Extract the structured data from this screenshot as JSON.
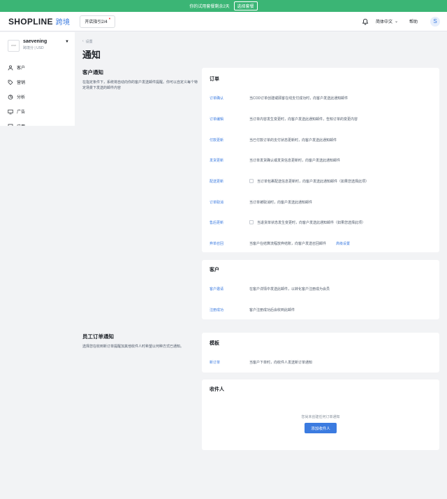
{
  "banner": {
    "text": "你的试用套餐剩余2天",
    "button": "选择套餐"
  },
  "topbar": {
    "logo": "SHOPLINE",
    "logo_sub": "跨境",
    "guide": "开店指引2/4",
    "language": "简体中文",
    "help": "帮助",
    "avatar": "S"
  },
  "sidebar": {
    "store_logo": "LOGO",
    "store_name": "saevening",
    "store_sub": "跨境分 | USD",
    "items": [
      {
        "label": "客户",
        "icon": "user-icon"
      },
      {
        "label": "营销",
        "icon": "tag-icon"
      },
      {
        "label": "分析",
        "icon": "chart-icon"
      },
      {
        "label": "广告",
        "icon": "monitor-icon"
      },
      {
        "label": "应用",
        "icon": "app-icon"
      }
    ]
  },
  "page": {
    "breadcrumb": "设置",
    "title": "通知"
  },
  "customer_section": {
    "title": "客户通知",
    "desc": "在指定条件下，系统将自动向你的客户发送邮件提醒。你可以自定义每个特定场景下发送的邮件内容"
  },
  "orders_card": {
    "title": "订单",
    "rows": [
      {
        "link": "订单确认",
        "text": "当COD订单创建或顾客在线支付成功时，向客户发送此通知邮件"
      },
      {
        "link": "订单编辑",
        "text": "当订单内容发生变更时，向客户发送此通知邮件，告知订单的变更内容"
      },
      {
        "link": "付款更新",
        "text": "当已付款订单的支付状态更新时，向客户发送此通知邮件"
      },
      {
        "link": "发货更新",
        "text": "当订单发货确认或发货信息更新时，向客户发送此通知邮件"
      },
      {
        "link": "配送更新",
        "text": "当订单包裹配送信息更新时，向客户发送此通知邮件（如果您选择此项）"
      },
      {
        "link": "订单取消",
        "text": "当订单被取消时，向客户发送此通知邮件"
      },
      {
        "link": "售后更新",
        "text": "当退货单状态发生变更时，向客户发送此通知邮件（如果您选择此项）"
      },
      {
        "link": "弃单召回",
        "text": "当客户在结算流程放弃结账，向客户发送召回邮件",
        "extra": "高级设置"
      }
    ]
  },
  "customers_card": {
    "title": "客户",
    "rows": [
      {
        "link": "客户邀请",
        "text": "在客户详情中发送此邮件，以转化客户注册成为会员"
      },
      {
        "link": "注册成功",
        "text": "客户注册成功后会收到此邮件"
      }
    ]
  },
  "staff_section": {
    "title": "员工订单通知",
    "desc": "选择您在收到新订单提醒加其他收件人时希望以何种方式已通知。"
  },
  "template_card": {
    "title": "模板",
    "rows": [
      {
        "link": "新订单",
        "text": "当客户下单时，向收件人发送新订单通知"
      }
    ]
  },
  "recipients_card": {
    "title": "收件人",
    "empty_text": "您尚未创建任何订单通知",
    "add_button": "添加收件人"
  },
  "colors": {
    "accent": "#3b7be0",
    "banner": "#3bb575",
    "background": "#f2f3f5"
  }
}
